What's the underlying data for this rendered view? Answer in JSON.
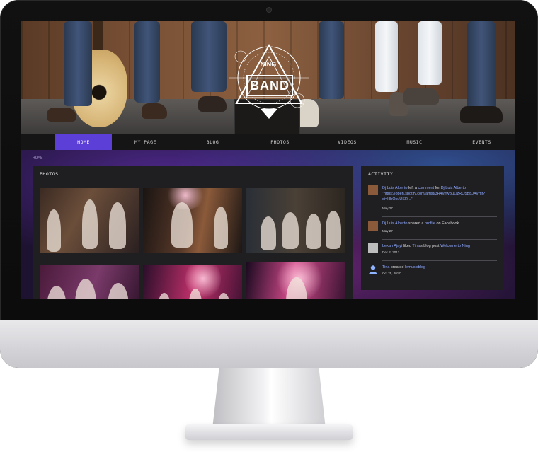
{
  "nav": {
    "items": [
      "HOME",
      "MY PAGE",
      "BLOG",
      "PHOTOS",
      "VIDEOS",
      "MUSIC",
      "EVENTS"
    ]
  },
  "breadcrumb": "HOME",
  "banner": {
    "logo_top": "NING",
    "logo_main": "BAND"
  },
  "photos": {
    "title": "PHOTOS"
  },
  "activity": {
    "title": "ACTIVITY",
    "entries": [
      {
        "actor": "Dj Luis Alberto",
        "verb": "left a",
        "object": "comment",
        "prep": "for",
        "target": "Dj Luis Alberto",
        "quote": "\"https://open.spotify.com/artist/3R4vnwBuLlzRO5BbJAVmf?si=HbOsuUSR...\"",
        "date": "May 27"
      },
      {
        "actor": "Dj Luis Alberto",
        "verb": "shared a",
        "object": "profile",
        "prep": "on Facebook",
        "date": "May 27"
      },
      {
        "actor": "Lekan Ajayi",
        "verb": "liked",
        "object": "Tina",
        "prep": "'s blog post",
        "target": "Welcome to Ning",
        "date": "Dec 2, 2017"
      },
      {
        "actor": "Tina",
        "verb": "created",
        "object": "lemusicblog",
        "date": "Oct 25, 2017"
      }
    ]
  },
  "colors": {
    "nav_active": "#5b3fd6",
    "link": "#8ea8ff",
    "panel": "#1f1f22"
  }
}
